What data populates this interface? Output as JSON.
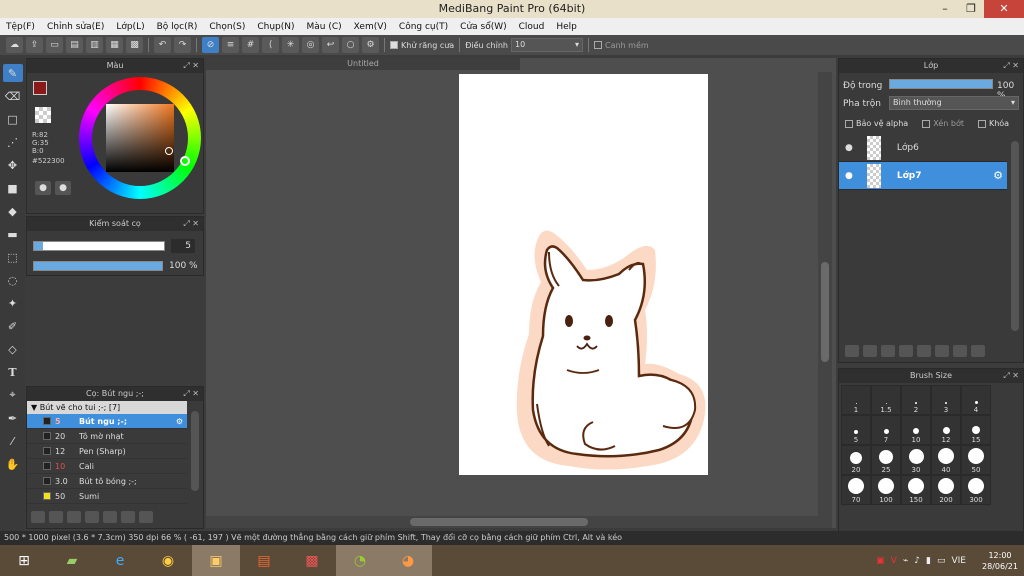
{
  "window": {
    "title": "MediBang Paint Pro (64bit)",
    "min": "–",
    "max": "❐",
    "close": "✕"
  },
  "menu": [
    "Tệp(F)",
    "Chỉnh sửa(E)",
    "Lớp(L)",
    "Bộ lọc(R)",
    "Chọn(S)",
    "Chụp(N)",
    "Màu (C)",
    "Xem(V)",
    "Công cụ(T)",
    "Cửa sổ(W)",
    "Cloud",
    "Help"
  ],
  "toolbar": {
    "antialias_label": "Khử răng cưa",
    "adjust_label": "Điều chỉnh",
    "adjust_value": "10",
    "edge_label": "Canh mềm"
  },
  "document": {
    "tab_title": "Untitled"
  },
  "color_panel": {
    "title": "Màu",
    "r": "R:82",
    "g": "G:35",
    "b": "B:0",
    "hex": "#522300",
    "fg_color": "#8b1a1a"
  },
  "brush_control": {
    "title": "Kiểm soát cọ",
    "size": "5",
    "opacity": "100 %",
    "opacity_fraction": 1.0,
    "size_fraction": 0.05
  },
  "brush_panel": {
    "title": "Cọ: Bút ngu ;-;",
    "group": "Bút vẽ cho tui ;-; [7]",
    "items": [
      {
        "size": "5",
        "name": "Bút ngu ;-;",
        "swatch": "#222222",
        "size_color": "#e05050"
      },
      {
        "size": "20",
        "name": "Tô mờ nhạt",
        "swatch": "#222222",
        "size_color": "#dddddd"
      },
      {
        "size": "12",
        "name": "Pen (Sharp)",
        "swatch": "#222222",
        "size_color": "#dddddd"
      },
      {
        "size": "10",
        "name": "Cali",
        "swatch": "#222222",
        "size_color": "#e05050"
      },
      {
        "size": "3.0",
        "name": "Bút tô bóng ;-;",
        "swatch": "#222222",
        "size_color": "#dddddd"
      },
      {
        "size": "50",
        "name": "Sumi",
        "swatch": "#f0e020",
        "size_color": "#dddddd"
      }
    ]
  },
  "layer_panel": {
    "title": "Lớp",
    "opacity_label": "Độ trong",
    "opacity_value": "100 %",
    "blend_label": "Pha trộn",
    "blend_value": "Bình thường",
    "protect_alpha": "Bảo vệ alpha",
    "clip": "Xén bớt",
    "lock": "Khóa",
    "layers": [
      {
        "name": "Lớp6",
        "selected": false
      },
      {
        "name": "Lớp7",
        "selected": true
      }
    ]
  },
  "brush_size_panel": {
    "title": "Brush Size",
    "sizes": [
      "1",
      "1.5",
      "2",
      "3",
      "4",
      "5",
      "7",
      "10",
      "12",
      "15",
      "20",
      "25",
      "30",
      "40",
      "50",
      "70",
      "100",
      "150",
      "200",
      "300"
    ]
  },
  "status": {
    "text": "500 * 1000 pixel   (3.6 * 7.3cm)   350 dpi   66 %   ( -61, 197 )   Vẽ một đường thẳng bằng cách giữ phím Shift, Thay đổi cỡ cọ bằng cách giữ phím Ctrl, Alt và kéo"
  },
  "taskbar": {
    "lang": "VIE",
    "time": "12:00",
    "date": "28/06/21"
  }
}
